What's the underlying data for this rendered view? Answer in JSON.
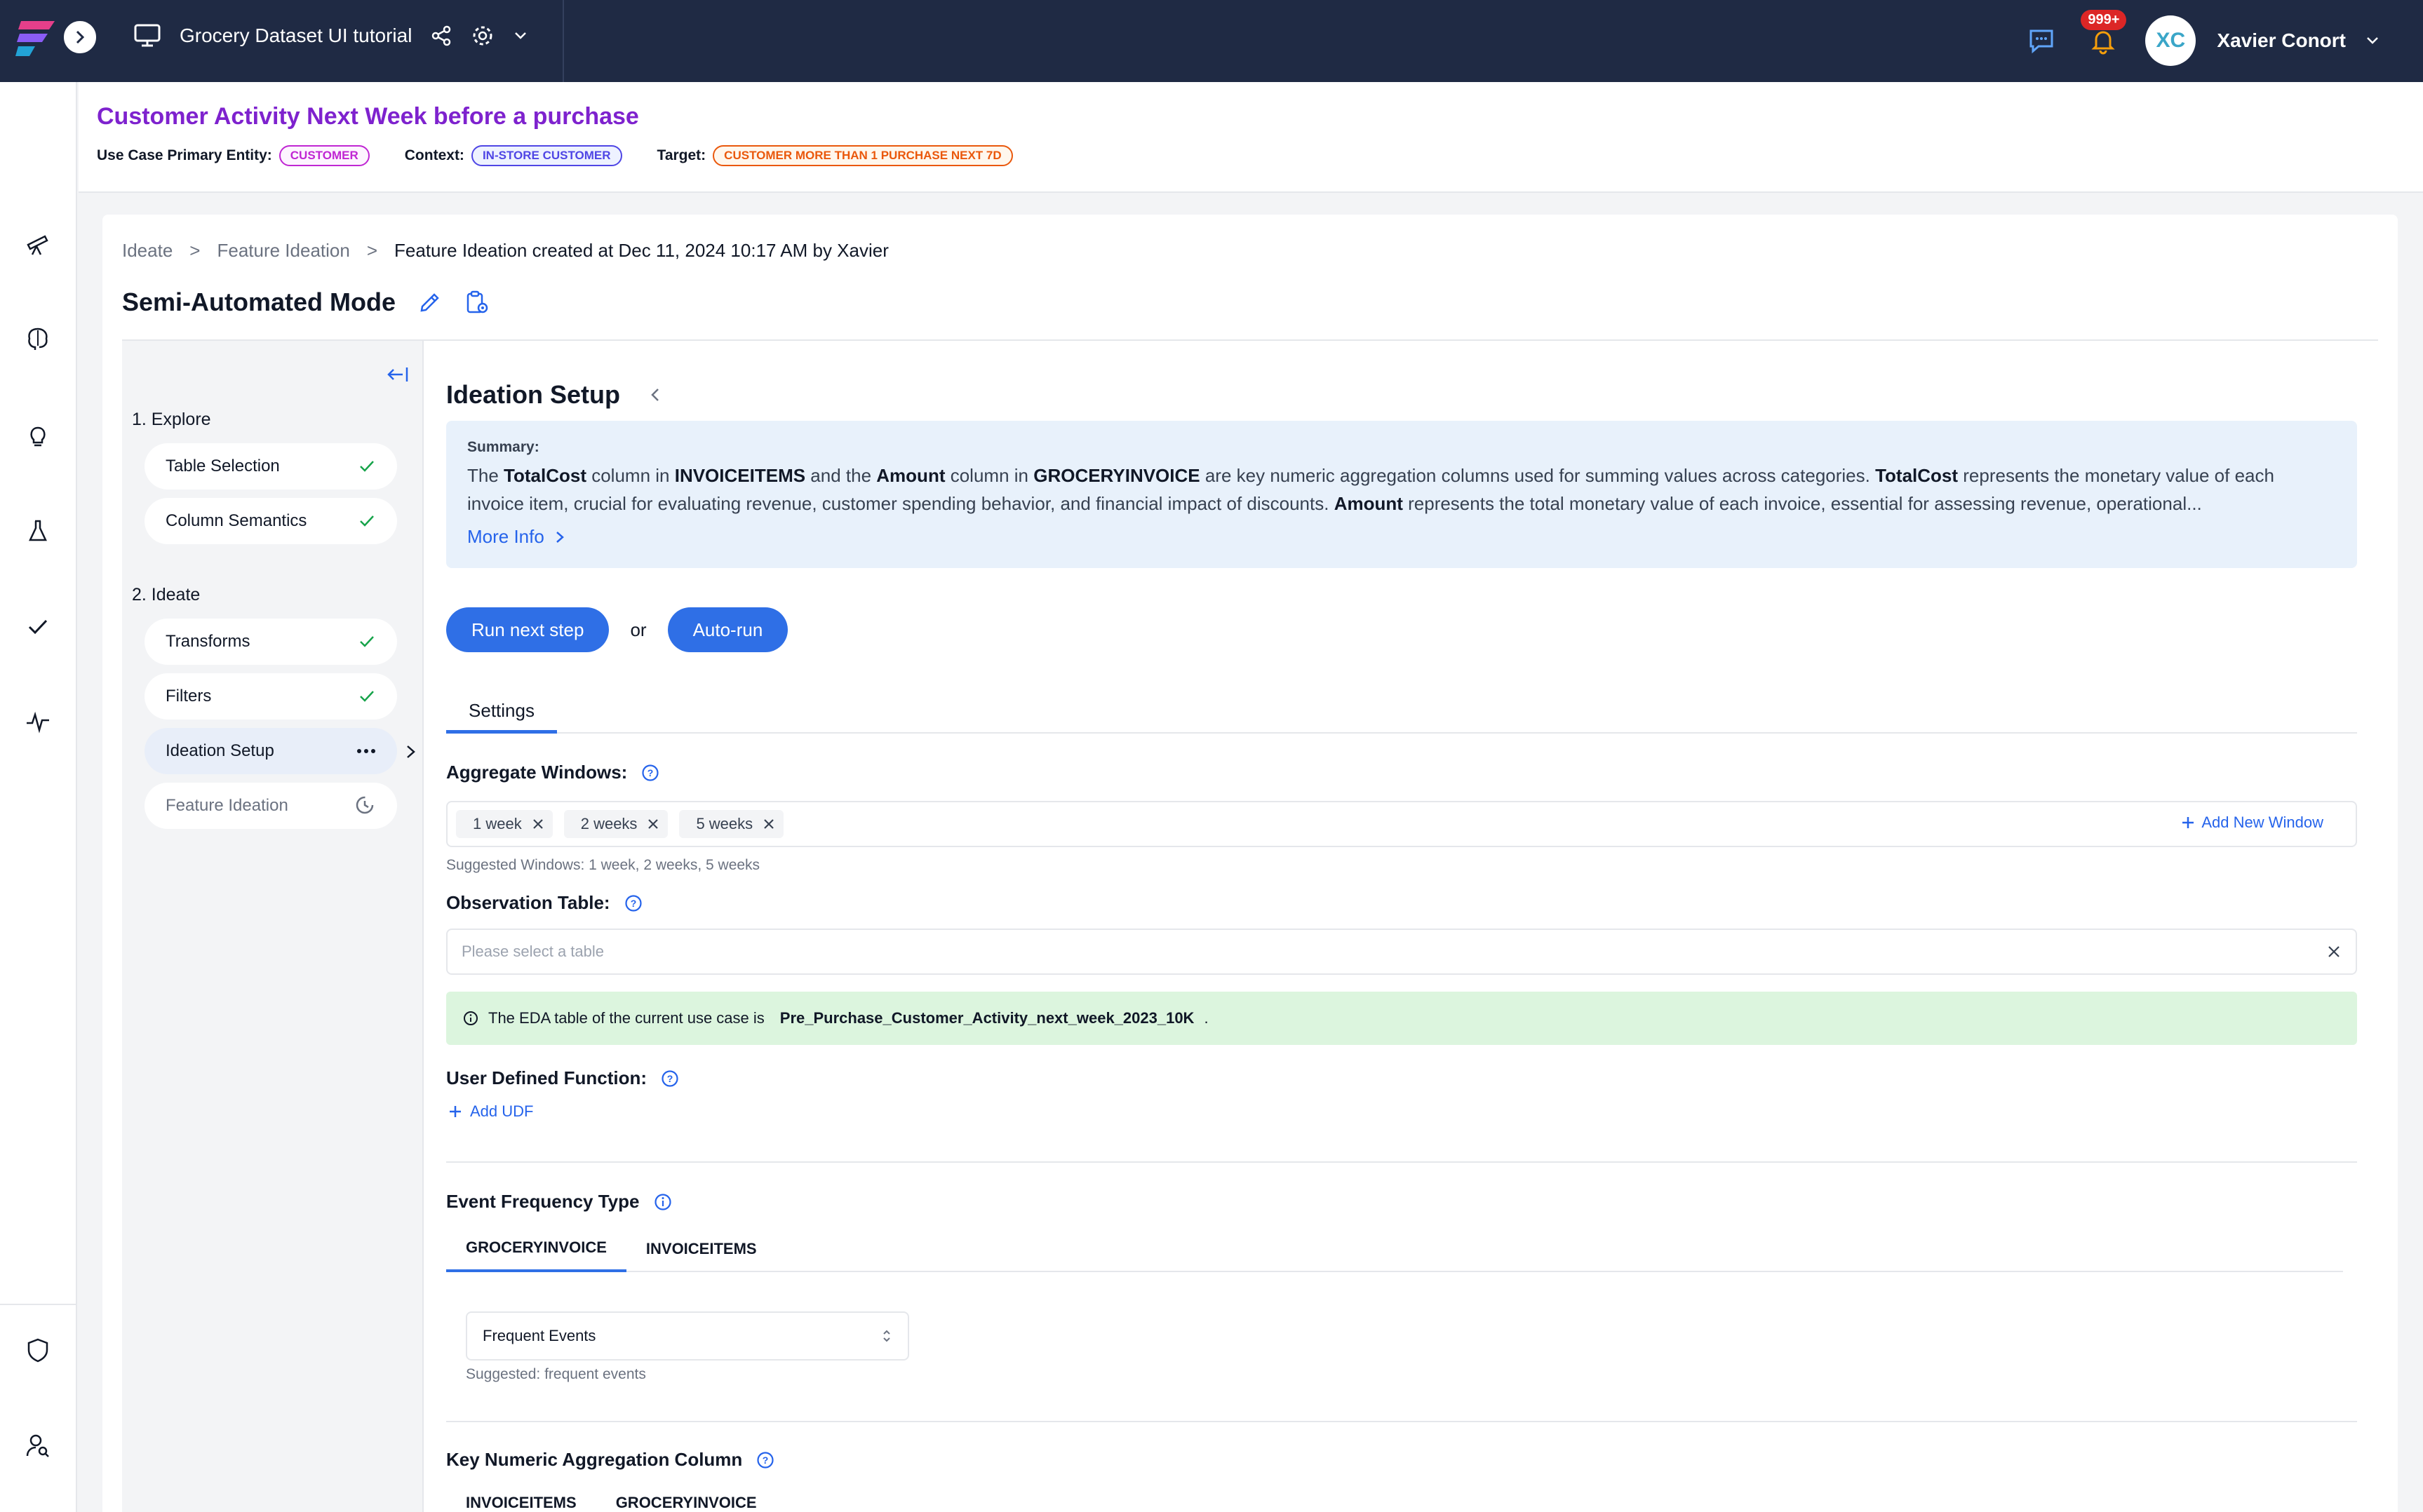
{
  "topbar": {
    "project_title": "Grocery Dataset UI tutorial",
    "notifications_badge": "999+",
    "avatar_initials": "XC",
    "user_name": "Xavier Conort"
  },
  "use_case": {
    "title": "Customer Activity Next Week before a purchase",
    "primary_entity_label": "Use Case Primary Entity:",
    "primary_entity": "CUSTOMER",
    "context_label": "Context:",
    "context": "IN-STORE CUSTOMER",
    "target_label": "Target:",
    "target": "CUSTOMER MORE THAN 1 PURCHASE NEXT 7D"
  },
  "breadcrumb": {
    "items": [
      "Ideate",
      ">",
      "Feature Ideation",
      ">"
    ],
    "current": "Feature Ideation created at Dec 11, 2024 10:17 AM by Xavier"
  },
  "mode_title": "Semi-Automated Mode",
  "stepper": {
    "explore_label": "1. Explore",
    "ideate_label": "2. Ideate",
    "steps": [
      {
        "label": "Table Selection",
        "status": "done"
      },
      {
        "label": "Column Semantics",
        "status": "done"
      },
      {
        "label": "Transforms",
        "status": "done"
      },
      {
        "label": "Filters",
        "status": "done"
      },
      {
        "label": "Ideation Setup",
        "status": "in-progress"
      },
      {
        "label": "Feature Ideation",
        "status": "pending"
      }
    ]
  },
  "ideation": {
    "title": "Ideation Setup",
    "summary_label": "Summary:",
    "summary": {
      "t1": "The ",
      "b1": "TotalCost",
      "t2": " column in ",
      "b2": "INVOICEITEMS",
      "t3": " and the ",
      "b3": "Amount",
      "t4": " column in ",
      "b4": "GROCERYINVOICE",
      "t5": " are key numeric aggregation columns used for summing values across categories. ",
      "b5": "TotalCost",
      "t6": " represents the monetary value of each invoice item, crucial for evaluating revenue, customer spending behavior, and financial impact of discounts. ",
      "b6": "Amount",
      "t7": " represents the total monetary value of each invoice, essential for assessing revenue, operational..."
    },
    "more_info": "More Info",
    "run_next_step": "Run next step",
    "or": "or",
    "auto_run": "Auto-run",
    "settings_tab": "Settings",
    "aggregate_windows_label": "Aggregate Windows:",
    "windows": [
      "1 week",
      "2 weeks",
      "5 weeks"
    ],
    "add_new_window": "Add New Window",
    "suggested_windows": "Suggested Windows: 1 week, 2 weeks, 5 weeks",
    "observation_table_label": "Observation Table:",
    "observation_table_placeholder": "Please select a table",
    "eda_text": "The EDA table of the current use case is",
    "eda_table": "Pre_Purchase_Customer_Activity_next_week_2023_10K",
    "eda_period": ".",
    "udf_label": "User Defined Function:",
    "add_udf": "Add UDF",
    "event_frequency_label": "Event Frequency Type",
    "event_tabs": [
      "GROCERYINVOICE",
      "INVOICEITEMS"
    ],
    "frequency_value": "Frequent Events",
    "frequency_suggested": "Suggested: frequent events",
    "key_numeric_label": "Key Numeric Aggregation Column",
    "key_numeric_tabs": [
      "INVOICEITEMS",
      "GROCERYINVOICE"
    ]
  },
  "colors": {
    "topbar": "#1f2a44",
    "accent": "#2f6fe6",
    "title_purple": "#7e22ce",
    "entity_pill": "#c026d3",
    "context_pill": "#4f46e5",
    "target_pill": "#ea580c",
    "success_green": "#16a34a"
  }
}
